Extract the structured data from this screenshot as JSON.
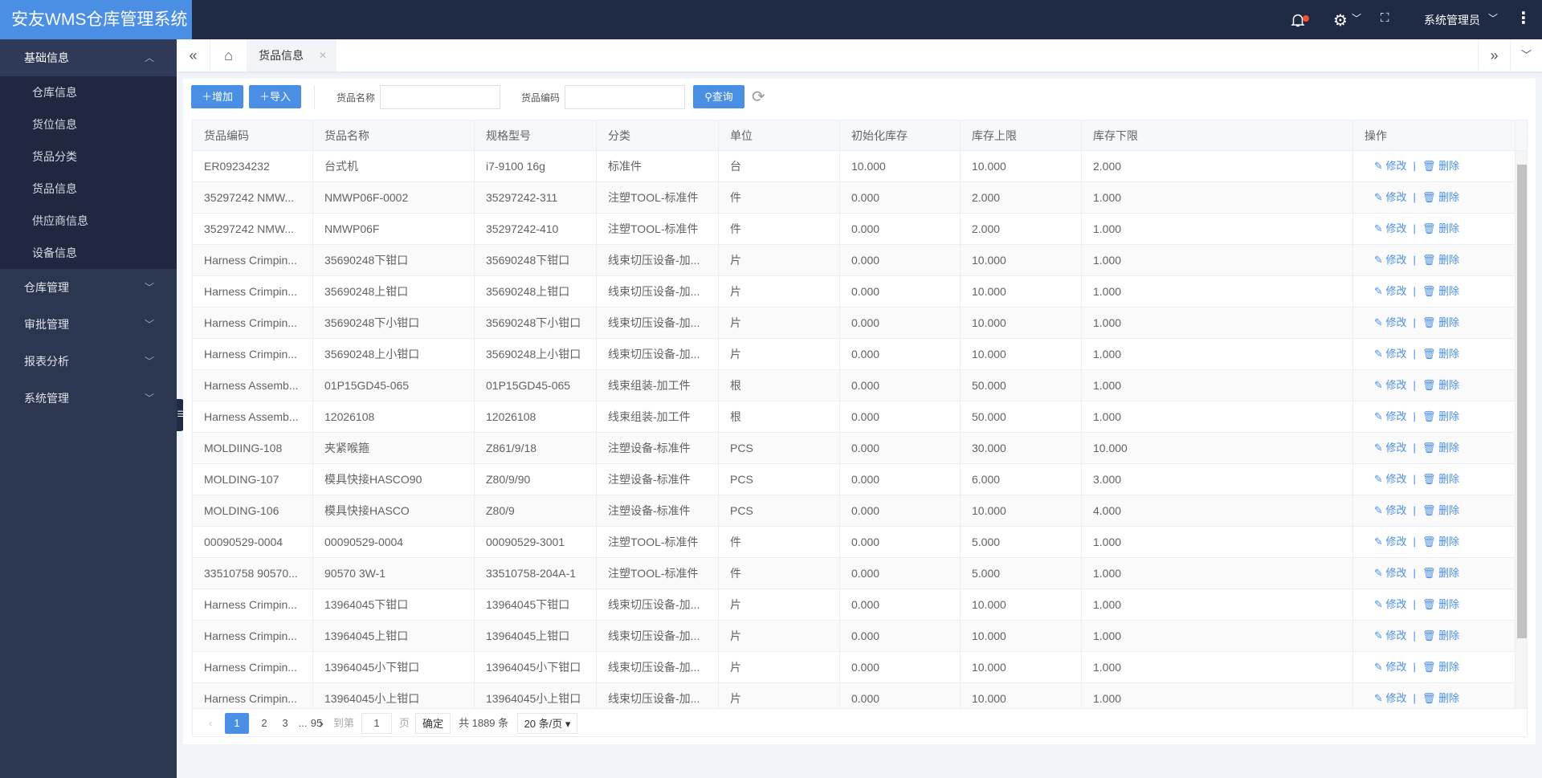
{
  "header": {
    "logo": "安友WMS仓库管理系统",
    "user": "系统管理员",
    "icons": [
      "bell-icon",
      "gear-icon",
      "fullscreen-icon",
      "more-icon"
    ],
    "notification_dot_color": "#f3522c"
  },
  "sidebar": {
    "open_group": "基础信息",
    "sub_items": [
      "仓库信息",
      "货位信息",
      "货品分类",
      "货品信息",
      "供应商信息",
      "设备信息"
    ],
    "groups": [
      "仓库管理",
      "审批管理",
      "报表分析",
      "系统管理"
    ]
  },
  "tabs": {
    "active": "货品信息"
  },
  "toolbar": {
    "add": "增加",
    "import": "导入",
    "name_label": "货品名称",
    "name_value": "",
    "code_label": "货品编码",
    "code_value": "",
    "query": "查询"
  },
  "table": {
    "columns": [
      "货品编码",
      "货品名称",
      "规格型号",
      "分类",
      "单位",
      "初始化库存",
      "库存上限",
      "库存下限",
      "操作"
    ],
    "edit": "修改",
    "delete": "删除",
    "rows": [
      [
        "ER09234232",
        "台式机",
        "i7-9100 16g",
        "标准件",
        "台",
        "10.000",
        "10.000",
        "2.000"
      ],
      [
        "35297242 NMW...",
        "NMWP06F-0002",
        "35297242-311",
        "注塑TOOL-标准件",
        "件",
        "0.000",
        "2.000",
        "1.000"
      ],
      [
        "35297242 NMW...",
        "NMWP06F",
        "35297242-410",
        "注塑TOOL-标准件",
        "件",
        "0.000",
        "2.000",
        "1.000"
      ],
      [
        "Harness Crimpin...",
        "35690248下钳口",
        "35690248下钳口",
        "线束切压设备-加...",
        "片",
        "0.000",
        "10.000",
        "1.000"
      ],
      [
        "Harness Crimpin...",
        "35690248上钳口",
        "35690248上钳口",
        "线束切压设备-加...",
        "片",
        "0.000",
        "10.000",
        "1.000"
      ],
      [
        "Harness Crimpin...",
        "35690248下小钳口",
        "35690248下小钳口",
        "线束切压设备-加...",
        "片",
        "0.000",
        "10.000",
        "1.000"
      ],
      [
        "Harness Crimpin...",
        "35690248上小钳口",
        "35690248上小钳口",
        "线束切压设备-加...",
        "片",
        "0.000",
        "10.000",
        "1.000"
      ],
      [
        "Harness Assemb...",
        "01P15GD45-065",
        "01P15GD45-065",
        "线束组装-加工件",
        "根",
        "0.000",
        "50.000",
        "1.000"
      ],
      [
        "Harness Assemb...",
        "12026108",
        "12026108",
        "线束组装-加工件",
        "根",
        "0.000",
        "50.000",
        "1.000"
      ],
      [
        "MOLDIING-108",
        "夹紧喉箍",
        "Z861/9/18",
        "注塑设备-标准件",
        "PCS",
        "0.000",
        "30.000",
        "10.000"
      ],
      [
        "MOLDING-107",
        "模具快接HASCO90",
        "Z80/9/90",
        "注塑设备-标准件",
        "PCS",
        "0.000",
        "6.000",
        "3.000"
      ],
      [
        "MOLDING-106",
        "模具快接HASCO",
        "Z80/9",
        "注塑设备-标准件",
        "PCS",
        "0.000",
        "10.000",
        "4.000"
      ],
      [
        "00090529-0004",
        "00090529-0004",
        "00090529-3001",
        "注塑TOOL-标准件",
        "件",
        "0.000",
        "5.000",
        "1.000"
      ],
      [
        "33510758 90570...",
        "90570 3W-1",
        "33510758-204A-1",
        "注塑TOOL-标准件",
        "件",
        "0.000",
        "5.000",
        "1.000"
      ],
      [
        "Harness Crimpin...",
        "13964045下钳口",
        "13964045下钳口",
        "线束切压设备-加...",
        "片",
        "0.000",
        "10.000",
        "1.000"
      ],
      [
        "Harness Crimpin...",
        "13964045上钳口",
        "13964045上钳口",
        "线束切压设备-加...",
        "片",
        "0.000",
        "10.000",
        "1.000"
      ],
      [
        "Harness Crimpin...",
        "13964045小下钳口",
        "13964045小下钳口",
        "线束切压设备-加...",
        "片",
        "0.000",
        "10.000",
        "1.000"
      ],
      [
        "Harness Crimpin...",
        "13964045小上钳口",
        "13964045小上钳口",
        "线束切压设备-加...",
        "片",
        "0.000",
        "10.000",
        "1.000"
      ]
    ]
  },
  "pagination": {
    "pages": [
      "1",
      "2",
      "3",
      "...",
      "95"
    ],
    "current": "1",
    "goto_label": "到第",
    "goto_value": "1",
    "page_unit": "页",
    "confirm": "确定",
    "total": "共 1889 条",
    "page_size": "20 条/页"
  },
  "colors": {
    "accent": "#4a8fe3",
    "header_bg": "#1f2a44",
    "sidebar_bg": "#2b3651"
  }
}
